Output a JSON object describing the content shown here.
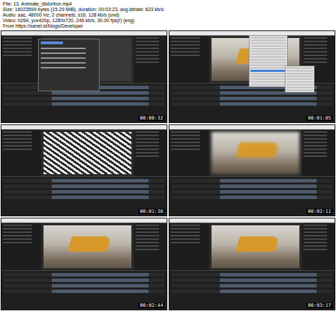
{
  "file_info": {
    "lines": [
      "File: 13. Animate_distortion.mp4",
      "Size: 16023599 bytes (15.29 MiB), duration: 00:03:23, avg.bitrate: 623 kb/s",
      "Audio: aac, 48000 Hz, 2 channels, s16, 128 kb/s (und)",
      "Video: h264, yuv420p, 1280x720, 246 kb/s, 30.00 fps(r) (eng)",
      "From https://sanet.st/blogs/Developer"
    ]
  },
  "frames": [
    {
      "kind": "dialog",
      "timestamp": "00:00:32"
    },
    {
      "kind": "menu",
      "timestamp": "00:01:05"
    },
    {
      "kind": "noise",
      "timestamp": "00:01:38"
    },
    {
      "kind": "blur",
      "timestamp": "00:02:11"
    },
    {
      "kind": "photo",
      "timestamp": "00:02:44"
    },
    {
      "kind": "photo",
      "timestamp": "00:03:17"
    }
  ]
}
